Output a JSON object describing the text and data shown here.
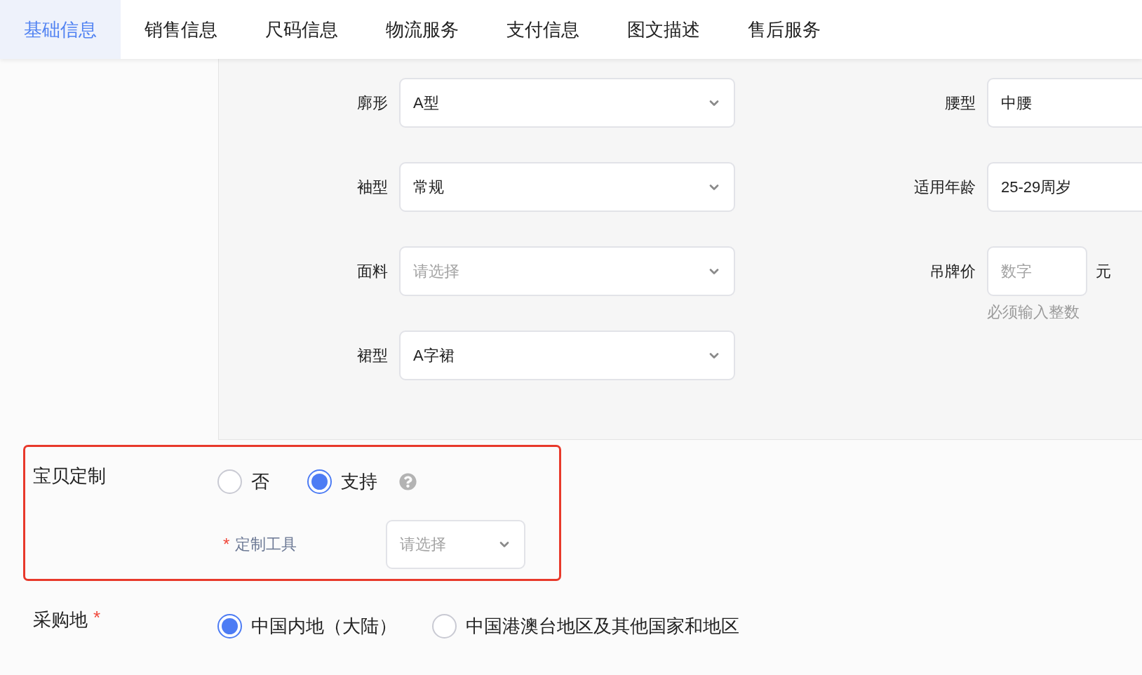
{
  "tabs": [
    {
      "label": "基础信息",
      "selected": true
    },
    {
      "label": "销售信息",
      "selected": false
    },
    {
      "label": "尺码信息",
      "selected": false
    },
    {
      "label": "物流服务",
      "selected": false
    },
    {
      "label": "支付信息",
      "selected": false
    },
    {
      "label": "图文描述",
      "selected": false
    },
    {
      "label": "售后服务",
      "selected": false
    }
  ],
  "attributes": {
    "left": [
      {
        "label": "廓形",
        "kind": "select",
        "value": "A型"
      },
      {
        "label": "袖型",
        "kind": "select",
        "value": "常规"
      },
      {
        "label": "面料",
        "kind": "select",
        "placeholder": "请选择"
      },
      {
        "label": "裙型",
        "kind": "select",
        "value": "A字裙"
      }
    ],
    "right": [
      {
        "label": "腰型",
        "kind": "input",
        "value": "中腰"
      },
      {
        "label": "适用年龄",
        "kind": "input",
        "value": "25-29周岁"
      },
      {
        "label": "吊牌价",
        "kind": "number",
        "placeholder": "数字",
        "unit": "元",
        "hint": "必须输入整数"
      }
    ]
  },
  "customization": {
    "label": "宝贝定制",
    "highlighted": true,
    "options": [
      {
        "label": "否",
        "selected": false
      },
      {
        "label": "支持",
        "selected": true
      }
    ],
    "tool": {
      "required_mark": "*",
      "label": "定制工具",
      "placeholder": "请选择"
    }
  },
  "purchase": {
    "label": "采购地",
    "required_mark": "*",
    "options": [
      {
        "label": "中国内地（大陆）",
        "selected": true
      },
      {
        "label": "中国港澳台地区及其他国家和地区",
        "selected": false
      }
    ]
  }
}
